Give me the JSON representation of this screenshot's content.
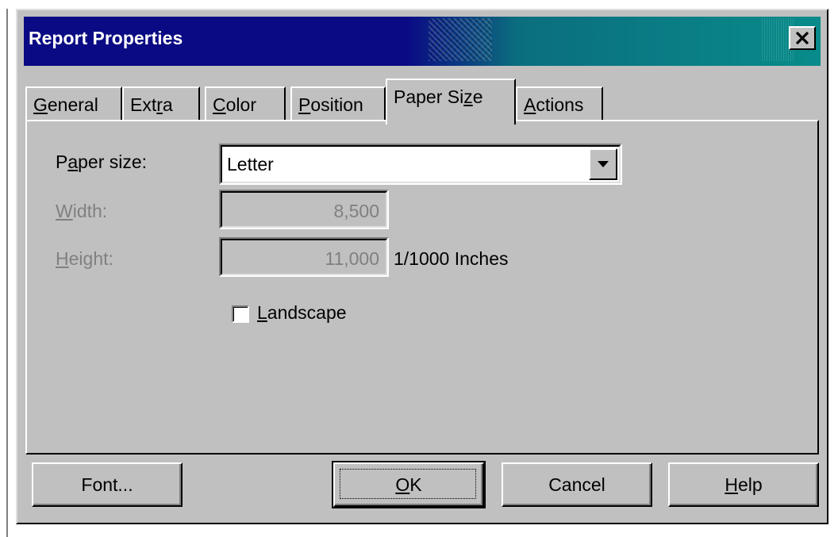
{
  "window": {
    "title": "Report Properties",
    "close_icon": "close-x-icon"
  },
  "tabs": [
    {
      "pre": "",
      "u": "G",
      "post": "eneral"
    },
    {
      "pre": "Ext",
      "u": "r",
      "post": "a"
    },
    {
      "pre": "",
      "u": "C",
      "post": "olor"
    },
    {
      "pre": "",
      "u": "P",
      "post": "osition"
    },
    {
      "pre": "Paper Si",
      "u": "z",
      "post": "e"
    },
    {
      "pre": "",
      "u": "A",
      "post": "ctions"
    }
  ],
  "active_tab": "Paper Size",
  "form": {
    "paper_size_label": {
      "pre": "P",
      "u": "a",
      "post": "per size:"
    },
    "paper_size_value": "Letter",
    "width_label": {
      "pre": "",
      "u": "W",
      "post": "idth:"
    },
    "width_value": "8,500",
    "height_label": {
      "pre": "",
      "u": "H",
      "post": "eight:"
    },
    "height_value": "11,000",
    "units": "1/1000 Inches",
    "landscape_label": {
      "pre": "",
      "u": "L",
      "post": "andscape"
    },
    "landscape_checked": false
  },
  "buttons": {
    "font": "Font...",
    "ok": {
      "pre": "",
      "u": "O",
      "post": "K"
    },
    "cancel": "Cancel",
    "help": {
      "pre": "",
      "u": "H",
      "post": "elp"
    }
  },
  "colors": {
    "face": "#c0c0c0",
    "title_start": "#0a0a84",
    "title_end": "#088b8a",
    "disabled_text": "#808080"
  }
}
